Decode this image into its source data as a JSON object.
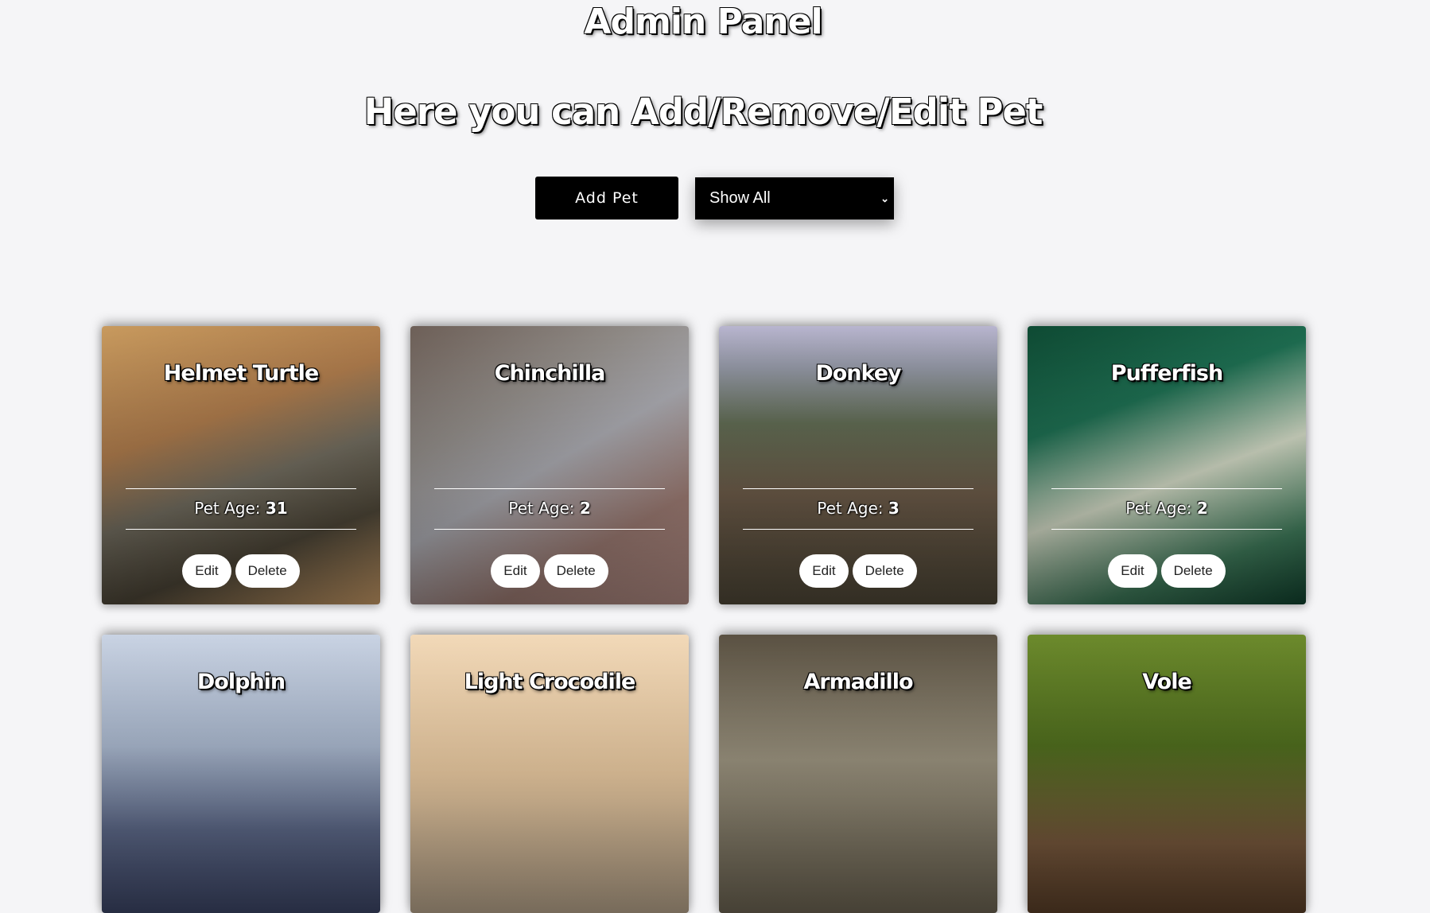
{
  "header": {
    "title": "Admin Panel",
    "subtitle": "Here you can Add/Remove/Edit Pet"
  },
  "controls": {
    "add_label": "Add Pet",
    "filter_value": "Show All",
    "filter_icon": "chevron-down-icon"
  },
  "labels": {
    "age_prefix": "Pet Age:",
    "edit": "Edit",
    "delete": "Delete"
  },
  "pets": [
    {
      "name": "Helmet Turtle",
      "age": "31",
      "bg": "linear-gradient(160deg,#c89a5e 0%,#a9784a 35%,#6f6a5d 55%,#4b4436 75%,#c79a66 100%)"
    },
    {
      "name": "Chinchilla",
      "age": "2",
      "bg": "linear-gradient(150deg,#6d5f57 0%,#8f8a86 30%,#a7a7ad 50%,#9b7a72 75%,#b08a82 100%)"
    },
    {
      "name": "Donkey",
      "age": "3",
      "bg": "linear-gradient(180deg,#b8b5cf 0%,#8f93a0 15%,#5f6a52 35%,#6b5a48 60%,#4d4636 100%)"
    },
    {
      "name": "Pufferfish",
      "age": "2",
      "bg": "linear-gradient(160deg,#0e4a33 0%,#1d6b4f 30%,#cfd6c2 55%,#3f7a5a 80%,#10402d 100%)"
    },
    {
      "name": "Dolphin",
      "age": "",
      "bg": "linear-gradient(180deg,#c9d3e3 0%,#a8b6cc 40%,#5e6a8a 70%,#3c4566 100%)"
    },
    {
      "name": "Light Crocodile",
      "age": "",
      "bg": "linear-gradient(180deg,#f2d9b8 0%,#e9c9a0 50%,#b7a48b 100%)"
    },
    {
      "name": "Armadillo",
      "age": "",
      "bg": "linear-gradient(180deg,#5a5142 0%,#9a927e 45%,#6c6452 100%)"
    },
    {
      "name": "Vole",
      "age": "",
      "bg": "linear-gradient(180deg,#6c8a2c 0%,#4f6d1e 40%,#7a5a3e 75%,#5a3f28 100%)"
    }
  ]
}
